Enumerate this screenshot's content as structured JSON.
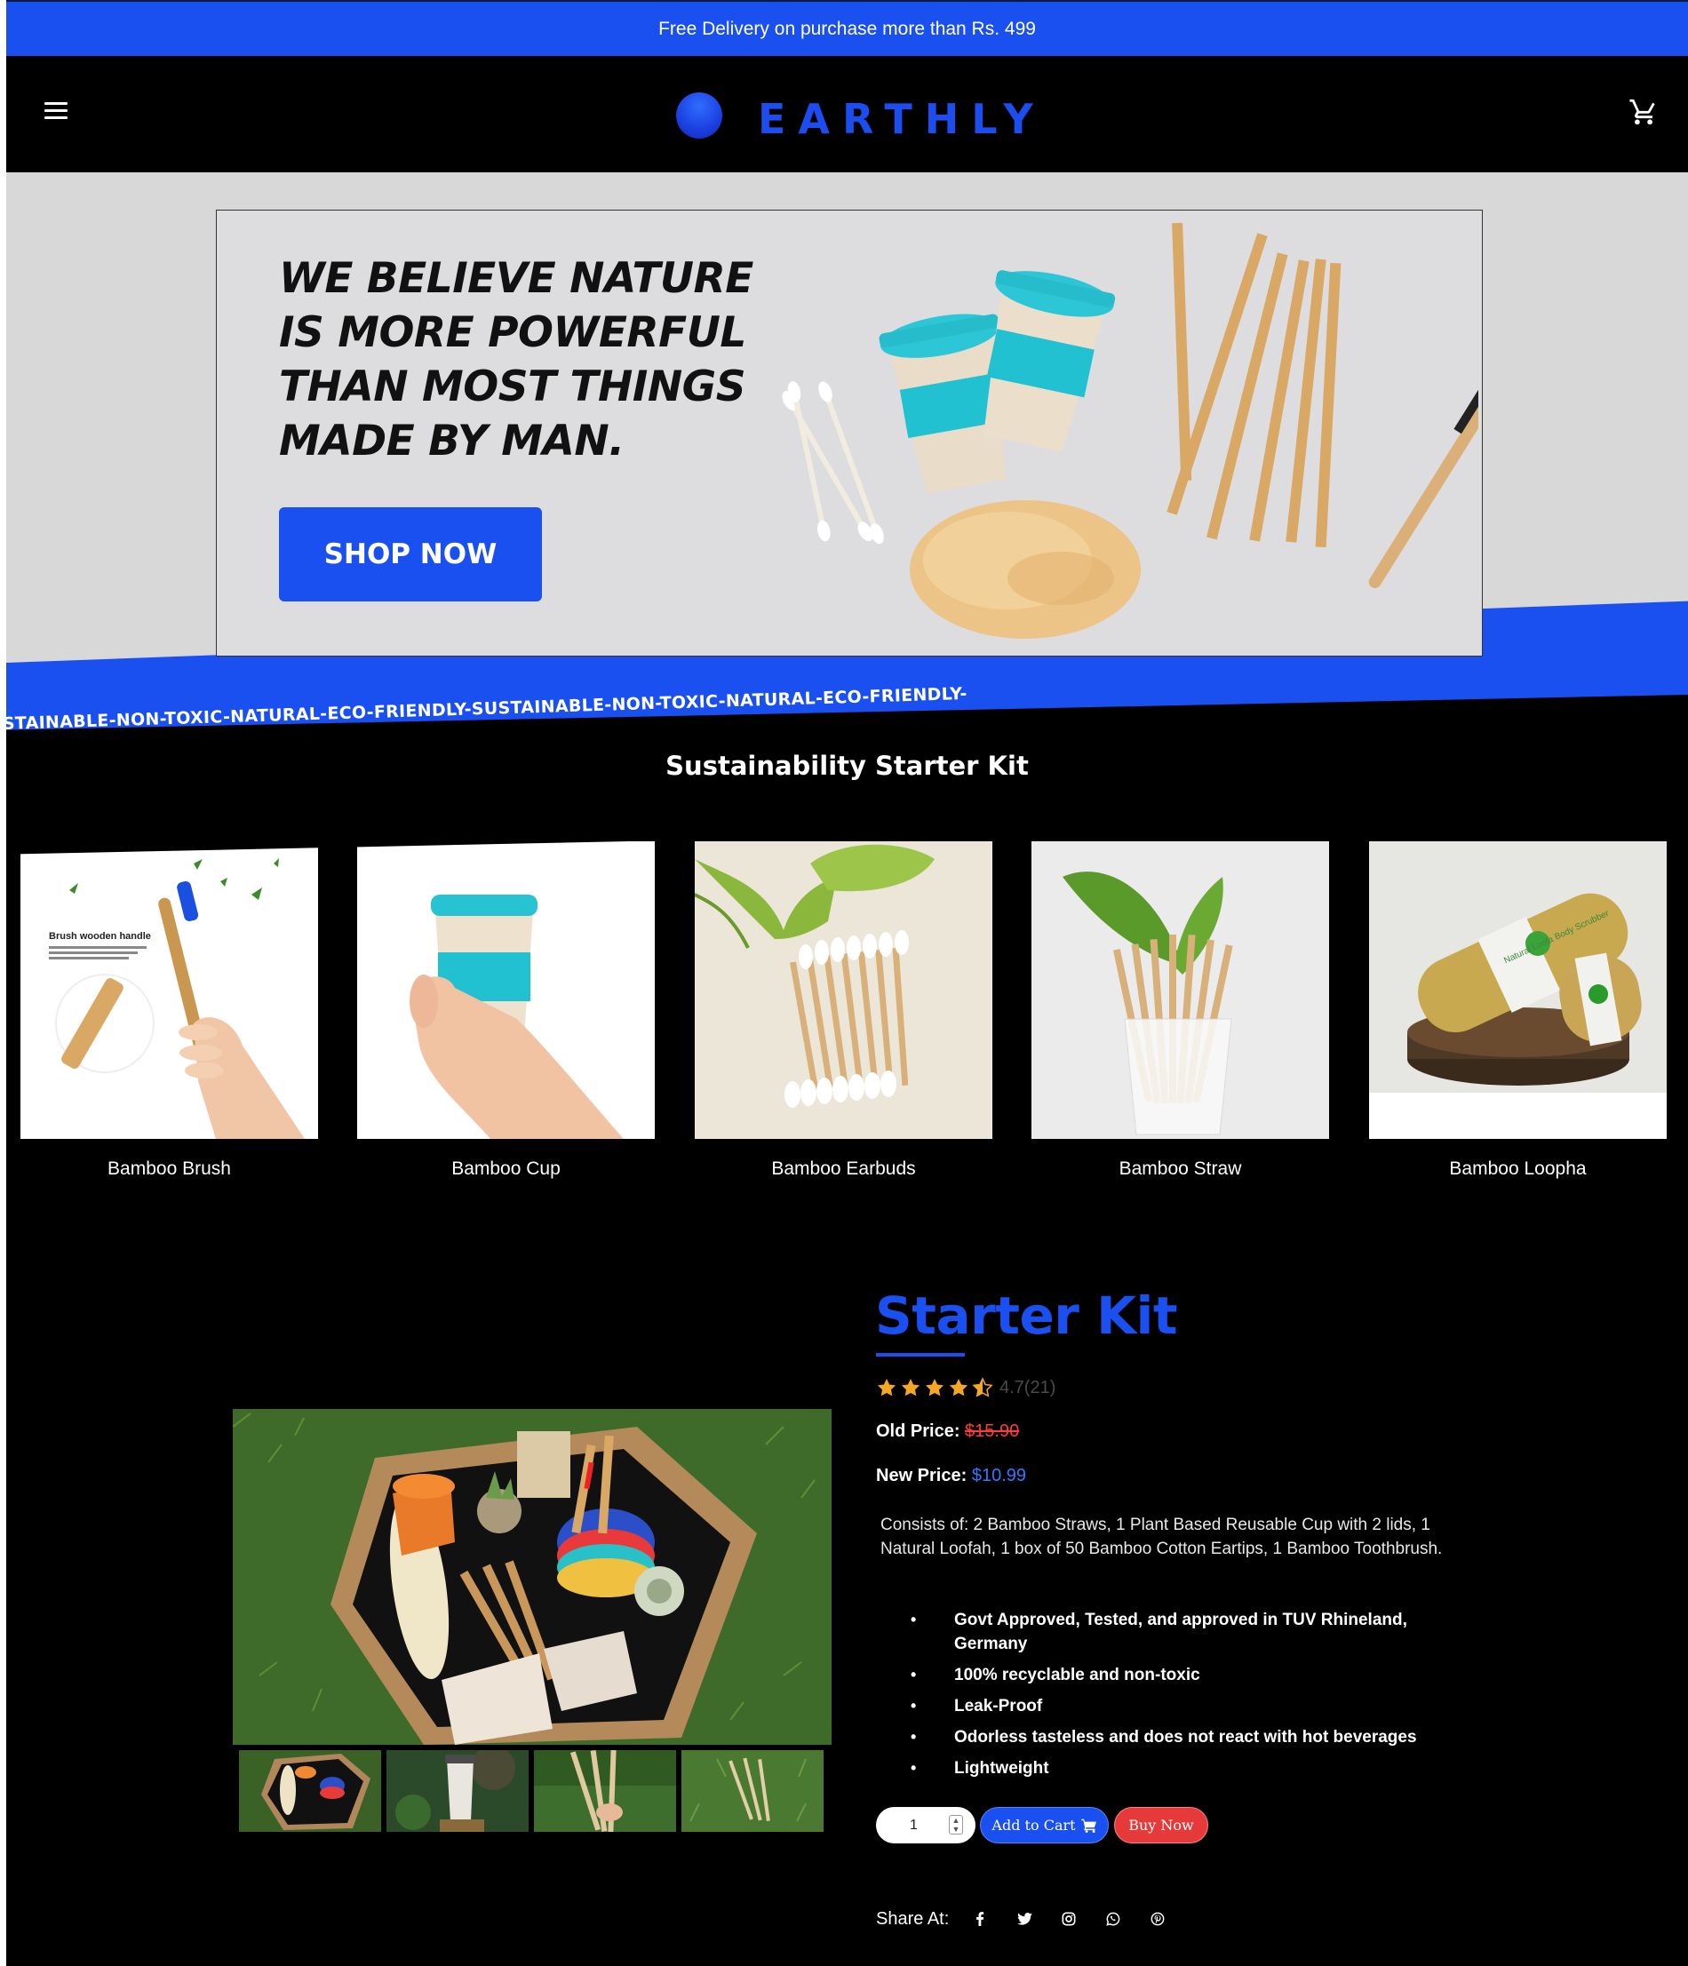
{
  "promo": {
    "text": "Free Delivery on purchase more than Rs. 499"
  },
  "header": {
    "brand": "EARTHLY",
    "menu_icon": "hamburger-menu-icon",
    "cart_icon": "shopping-cart-icon"
  },
  "hero": {
    "heading_lines": [
      "WE BELIEVE NATURE",
      "IS MORE POWERFUL",
      "THAN MOST THINGS",
      "MADE BY MAN."
    ],
    "cta_label": "SHOP NOW",
    "marquee": "STAINABLE-NON-TOXIC-NATURAL-ECO-FRIENDLY-SUSTAINABLE-NON-TOXIC-NATURAL-ECO-FRIENDLY-"
  },
  "kit_section": {
    "title": "Sustainability Starter Kit",
    "items": [
      {
        "label": "Bamboo Brush"
      },
      {
        "label": "Bamboo Cup"
      },
      {
        "label": "Bamboo Earbuds"
      },
      {
        "label": "Bamboo Straw"
      },
      {
        "label": "Bamboo Loopha"
      }
    ],
    "brush_caption": "Brush wooden handle",
    "loofah_tag": "Natural Loofa Body Scrubber"
  },
  "product": {
    "title": "Starter Kit",
    "rating_value": 4.5,
    "rating_text": "4.7(21)",
    "old_price_label": "Old Price:",
    "old_price": "$15.90",
    "new_price_label": "New Price:",
    "new_price": "$10.99",
    "description": "Consists of: 2 Bamboo Straws, 1 Plant Based Reusable Cup with 2 lids, 1 Natural Loofah, 1 box of 50 Bamboo Cotton Eartips, 1 Bamboo Toothbrush.",
    "features": [
      "Govt Approved, Tested, and approved in TUV Rhineland, Germany",
      "100% recyclable and non-toxic",
      "Leak-Proof",
      "Odorless tasteless and does not react with hot beverages",
      "Lightweight"
    ],
    "quantity": "1",
    "add_to_cart_label": "Add to Cart",
    "buy_now_label": "Buy Now",
    "share_label": "Share At:",
    "share_icons": [
      "facebook-icon",
      "twitter-icon",
      "instagram-icon",
      "whatsapp-icon",
      "pinterest-icon"
    ]
  },
  "colors": {
    "accent": "#1a4ff0",
    "danger": "#e63a3a",
    "background": "#000000",
    "hero_bg": "#d8d8d8"
  }
}
